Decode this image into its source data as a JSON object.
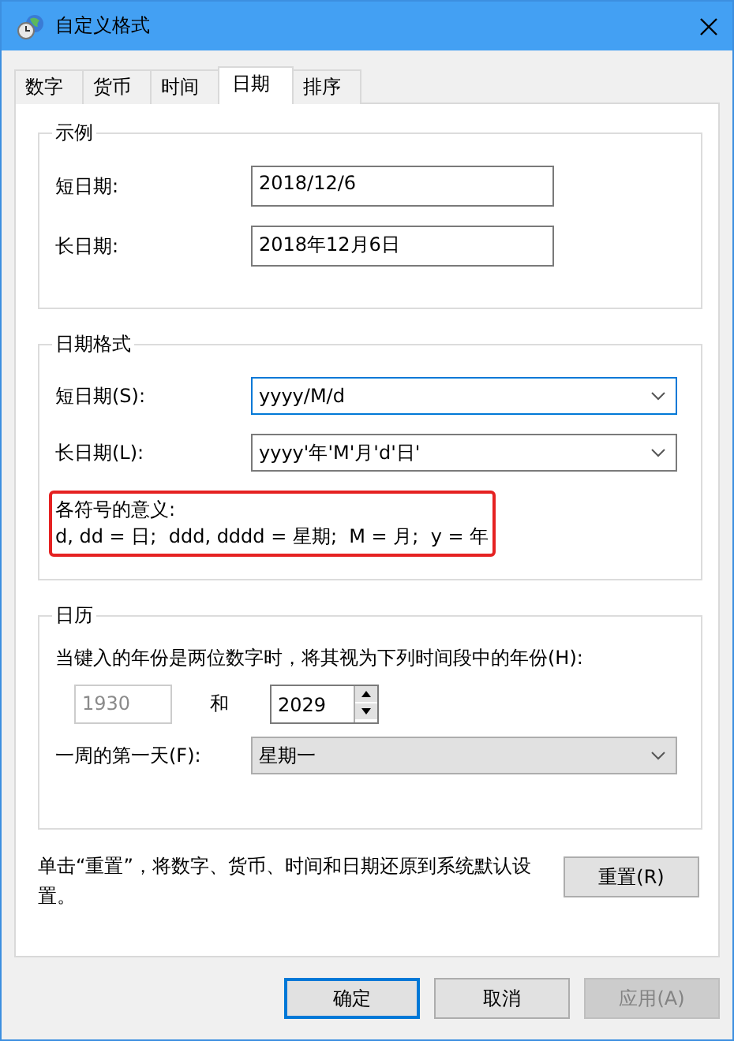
{
  "window": {
    "title": "自定义格式"
  },
  "tabs": [
    {
      "label": "数字",
      "selected": false
    },
    {
      "label": "货币",
      "selected": false
    },
    {
      "label": "时间",
      "selected": false
    },
    {
      "label": "日期",
      "selected": true
    },
    {
      "label": "排序",
      "selected": false
    }
  ],
  "example": {
    "title": "示例",
    "rows": [
      {
        "label": "短日期:",
        "value": "2018/12/6"
      },
      {
        "label": "长日期:",
        "value": "2018年12月6日"
      }
    ]
  },
  "date_format": {
    "title": "日期格式",
    "rows": [
      {
        "label": "短日期(S):",
        "value": "yyyy/M/d",
        "focused": true
      },
      {
        "label": "长日期(L):",
        "value": "yyyy'年'M'月'd'日'",
        "focused": false
      }
    ],
    "legend": {
      "highlighted": true,
      "lines": [
        "各符号的意义:",
        "d, dd = 日;  ddd, dddd = 星期;  M = 月;  y = 年"
      ]
    }
  },
  "calendar": {
    "title": "日历",
    "description": "当键入的年份是两位数字时，将其视为下列时间段中的年份(H):",
    "year_from": {
      "value": "1930",
      "disabled": true
    },
    "and_label": "和",
    "year_to": {
      "value": "2029"
    },
    "first_day": {
      "label": "一周的第一天(F):",
      "value": "星期一"
    }
  },
  "reset": {
    "text": "单击“重置”，将数字、货币、时间和日期还原到系统默认设置。",
    "button": "重置(R)"
  },
  "buttons": [
    {
      "label": "确定",
      "kind": "default",
      "disabled": false
    },
    {
      "label": "取消",
      "kind": "normal",
      "disabled": false
    },
    {
      "label": "应用(A)",
      "kind": "normal",
      "disabled": true
    }
  ]
}
